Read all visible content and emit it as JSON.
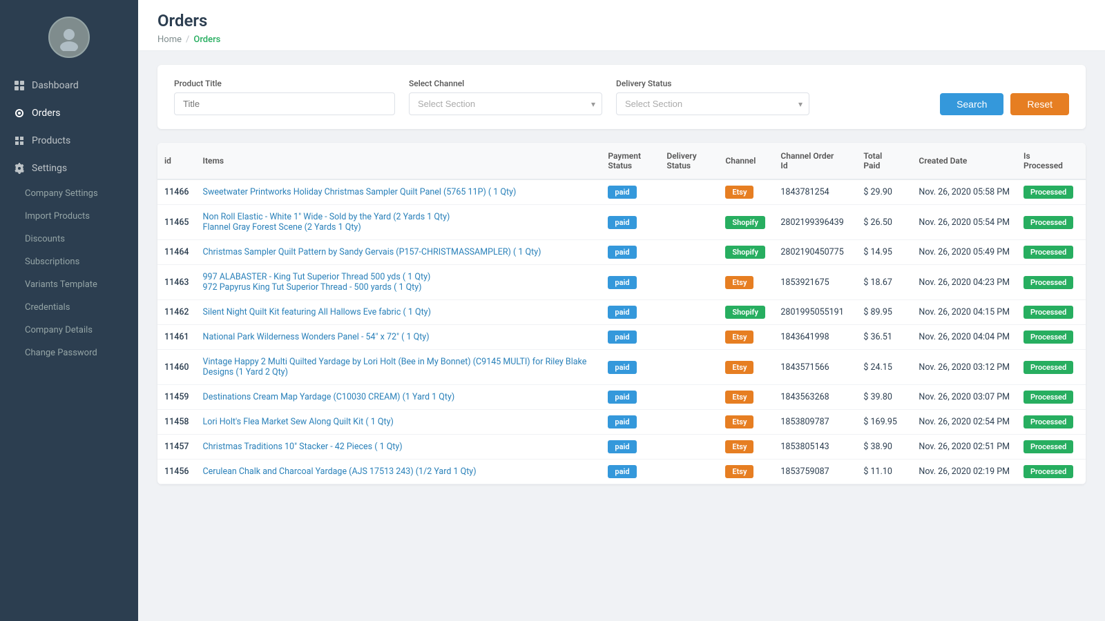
{
  "sidebar": {
    "nav_items": [
      {
        "id": "dashboard",
        "label": "Dashboard",
        "icon": "dashboard-icon",
        "active": false
      },
      {
        "id": "orders",
        "label": "Orders",
        "icon": "orders-icon",
        "active": true
      },
      {
        "id": "products",
        "label": "Products",
        "icon": "products-icon",
        "active": false
      },
      {
        "id": "settings",
        "label": "Settings",
        "icon": "settings-icon",
        "active": false
      }
    ],
    "sub_items": [
      {
        "id": "company-settings",
        "label": "Company Settings",
        "parent": "settings"
      },
      {
        "id": "import-products",
        "label": "Import Products",
        "parent": "settings"
      },
      {
        "id": "discounts",
        "label": "Discounts",
        "parent": "settings"
      },
      {
        "id": "subscriptions",
        "label": "Subscriptions",
        "parent": "settings"
      },
      {
        "id": "variants-template",
        "label": "Variants Template",
        "parent": "settings"
      },
      {
        "id": "credentials",
        "label": "Credentials",
        "parent": "settings"
      },
      {
        "id": "company-details",
        "label": "Company Details",
        "parent": "settings"
      },
      {
        "id": "change-password",
        "label": "Change Password",
        "parent": "settings"
      }
    ]
  },
  "header": {
    "page_title": "Orders",
    "breadcrumb_home": "Home",
    "breadcrumb_sep": "/",
    "breadcrumb_current": "Orders"
  },
  "filters": {
    "product_title_label": "Product Title",
    "product_title_placeholder": "Title",
    "select_channel_label": "Select Channel",
    "select_channel_placeholder": "Select Section",
    "delivery_status_label": "Delivery Status",
    "delivery_status_placeholder": "Select Section",
    "search_btn": "Search",
    "reset_btn": "Reset"
  },
  "table": {
    "columns": [
      "id",
      "Items",
      "Payment Status",
      "Delivery Status",
      "Channel",
      "Channel Order Id",
      "Total Paid",
      "Created Date",
      "Is Processed"
    ],
    "rows": [
      {
        "id": "11466",
        "items": "Sweetwater Printworks Holiday Christmas Sampler Quilt Panel (5765 11P) ( 1 Qty)",
        "items2": null,
        "payment_status": "paid",
        "delivery_status": "",
        "channel": "Etsy",
        "channel_order_id": "1843781254",
        "total_paid": "$ 29.90",
        "created_date": "Nov. 26, 2020 05:58 PM",
        "is_processed": "Processed"
      },
      {
        "id": "11465",
        "items": "Non Roll Elastic - White 1\" Wide - Sold by the Yard (2 Yards 1 Qty)",
        "items2": "Flannel Gray Forest Scene (2 Yards 1 Qty)",
        "payment_status": "paid",
        "delivery_status": "",
        "channel": "Shopify",
        "channel_order_id": "2802199396439",
        "total_paid": "$ 26.50",
        "created_date": "Nov. 26, 2020 05:54 PM",
        "is_processed": "Processed"
      },
      {
        "id": "11464",
        "items": "Christmas Sampler Quilt Pattern by Sandy Gervais (P157-CHRISTMASSAMPLER) ( 1 Qty)",
        "items2": null,
        "payment_status": "paid",
        "delivery_status": "",
        "channel": "Shopify",
        "channel_order_id": "2802190450775",
        "total_paid": "$ 14.95",
        "created_date": "Nov. 26, 2020 05:49 PM",
        "is_processed": "Processed"
      },
      {
        "id": "11463",
        "items": "997 ALABASTER - King Tut Superior Thread 500 yds ( 1 Qty)",
        "items2": "972 Papyrus King Tut Superior Thread - 500 yards ( 1 Qty)",
        "payment_status": "paid",
        "delivery_status": "",
        "channel": "Etsy",
        "channel_order_id": "1853921675",
        "total_paid": "$ 18.67",
        "created_date": "Nov. 26, 2020 04:23 PM",
        "is_processed": "Processed"
      },
      {
        "id": "11462",
        "items": "Silent Night Quilt Kit featuring All Hallows Eve fabric ( 1 Qty)",
        "items2": null,
        "payment_status": "paid",
        "delivery_status": "",
        "channel": "Shopify",
        "channel_order_id": "2801995055191",
        "total_paid": "$ 89.95",
        "created_date": "Nov. 26, 2020 04:15 PM",
        "is_processed": "Processed"
      },
      {
        "id": "11461",
        "items": "National Park Wilderness Wonders Panel - 54\" x 72\" ( 1 Qty)",
        "items2": null,
        "payment_status": "paid",
        "delivery_status": "",
        "channel": "Etsy",
        "channel_order_id": "1843641998",
        "total_paid": "$ 36.51",
        "created_date": "Nov. 26, 2020 04:04 PM",
        "is_processed": "Processed"
      },
      {
        "id": "11460",
        "items": "Vintage Happy 2 Multi Quilted Yardage by Lori Holt (Bee in My Bonnet) (C9145 MULTI) for Riley Blake Designs (1 Yard 2 Qty)",
        "items2": null,
        "payment_status": "paid",
        "delivery_status": "",
        "channel": "Etsy",
        "channel_order_id": "1843571566",
        "total_paid": "$ 24.15",
        "created_date": "Nov. 26, 2020 03:12 PM",
        "is_processed": "Processed"
      },
      {
        "id": "11459",
        "items": "Destinations Cream Map Yardage (C10030 CREAM) (1 Yard 1 Qty)",
        "items2": null,
        "payment_status": "paid",
        "delivery_status": "",
        "channel": "Etsy",
        "channel_order_id": "1843563268",
        "total_paid": "$ 39.80",
        "created_date": "Nov. 26, 2020 03:07 PM",
        "is_processed": "Processed"
      },
      {
        "id": "11458",
        "items": "Lori Holt's Flea Market Sew Along Quilt Kit ( 1 Qty)",
        "items2": null,
        "payment_status": "paid",
        "delivery_status": "",
        "channel": "Etsy",
        "channel_order_id": "1853809787",
        "total_paid": "$ 169.95",
        "created_date": "Nov. 26, 2020 02:54 PM",
        "is_processed": "Processed"
      },
      {
        "id": "11457",
        "items": "Christmas Traditions 10\" Stacker - 42 Pieces ( 1 Qty)",
        "items2": null,
        "payment_status": "paid",
        "delivery_status": "",
        "channel": "Etsy",
        "channel_order_id": "1853805143",
        "total_paid": "$ 38.90",
        "created_date": "Nov. 26, 2020 02:51 PM",
        "is_processed": "Processed"
      },
      {
        "id": "11456",
        "items": "Cerulean Chalk and Charcoal Yardage (AJS 17513 243) (1/2 Yard 1 Qty)",
        "items2": null,
        "payment_status": "paid",
        "delivery_status": "",
        "channel": "Etsy",
        "channel_order_id": "1853759087",
        "total_paid": "$ 11.10",
        "created_date": "Nov. 26, 2020 02:19 PM",
        "is_processed": "Processed"
      }
    ]
  }
}
